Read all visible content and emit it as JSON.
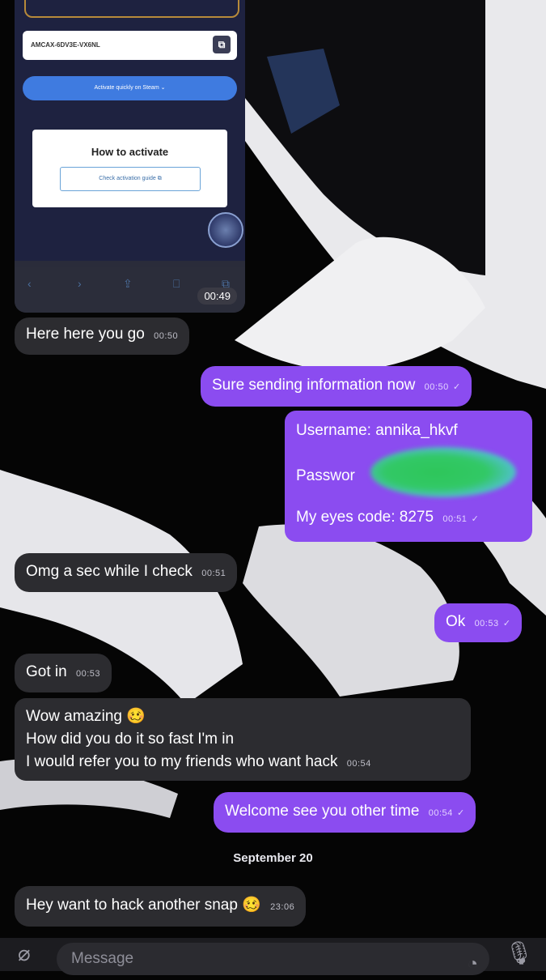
{
  "screenshot": {
    "code": "AMCAX-6DV3E-VX6NL",
    "steam_button": "Activate quickly on Steam",
    "card_title": "How to activate",
    "guide_button": "Check activation guide",
    "time": "00:49"
  },
  "messages": [
    {
      "side": "in",
      "text": "Here here you go",
      "time": "00:50"
    },
    {
      "side": "out",
      "text": "Sure sending information now",
      "time": "00:50"
    },
    {
      "side": "out",
      "lines": [
        "Username: annika_hkvf",
        "Passwor",
        "My eyes code: 8275"
      ],
      "time": "00:51"
    },
    {
      "side": "in",
      "text": "Omg a sec while I check",
      "time": "00:51"
    },
    {
      "side": "out",
      "text": "Ok",
      "time": "00:53"
    },
    {
      "side": "in",
      "text": "Got in",
      "time": "00:53"
    },
    {
      "side": "in",
      "lines": [
        "Wow amazing 🥴",
        "How did you do it so fast I'm in",
        "I would refer you to my friends who want hack"
      ],
      "time": "00:54"
    },
    {
      "side": "out",
      "text": "Welcome see you other time",
      "time": "00:54"
    },
    {
      "side": "in",
      "text": "Hey want to hack another snap 🥴",
      "time": "23:06"
    }
  ],
  "date_separator": "September 20",
  "composer": {
    "placeholder": "Message",
    "attach_icon": "paperclip-icon",
    "sticker_icon": "sticker-icon",
    "mic_icon": "microphone-icon"
  },
  "colors": {
    "incoming": "#2c2c30",
    "outgoing": "#8b4cf0",
    "background": "#050505"
  }
}
